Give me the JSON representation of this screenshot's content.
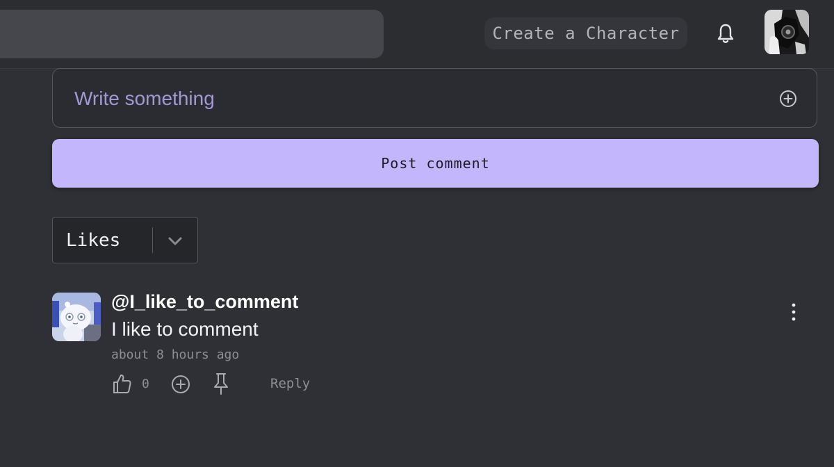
{
  "header": {
    "create_label": "Create a Character"
  },
  "composer": {
    "placeholder": "Write something",
    "post_label": "Post comment"
  },
  "sort": {
    "selected": "Likes"
  },
  "comments": [
    {
      "username": "@I_like_to_comment",
      "text": "I like to comment",
      "time": "about 8 hours ago",
      "likes": "0",
      "reply_label": "Reply"
    }
  ],
  "colors": {
    "accent": "#c3b6fd",
    "background": "#2e3035",
    "placeholder": "#a397d4"
  },
  "icons": [
    "bell-icon",
    "add-circle-icon",
    "chevron-down-icon",
    "more-vertical-icon",
    "thumbs-up-icon",
    "pin-icon"
  ]
}
